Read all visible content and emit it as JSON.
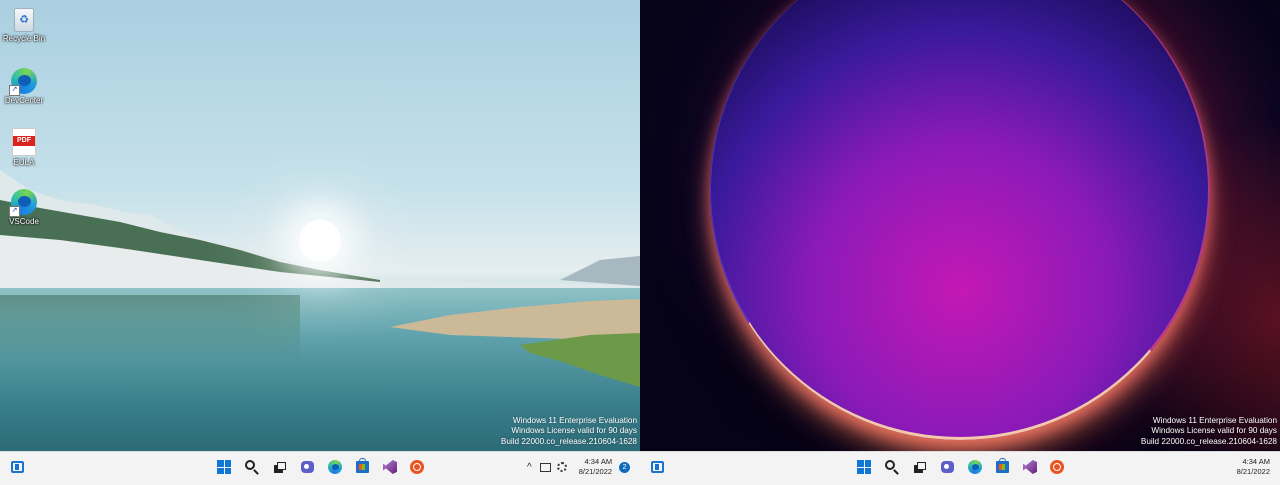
{
  "left_screen": {
    "desktop_icons": [
      {
        "label": "Recycle Bin",
        "icon": "recycle-bin-icon"
      },
      {
        "label": "DevCenter",
        "icon": "edge-icon"
      },
      {
        "label": "EULA",
        "icon": "pdf-icon",
        "badge": "PDF"
      },
      {
        "label": "VSCode",
        "icon": "edge-icon"
      }
    ],
    "watermark": [
      "Windows 11 Enterprise Evaluation",
      "Windows License valid for 90 days",
      "Build 22000.co_release.210604-1628"
    ],
    "taskbar": {
      "apps": [
        "widgets-icon",
        "start-icon",
        "search-icon",
        "task-view-icon",
        "chat-icon",
        "edge-icon",
        "store-icon",
        "visual-studio-icon",
        "ubuntu-icon"
      ],
      "tray_chevron": "^",
      "time": "4:34 AM",
      "date": "8/21/2022",
      "notification_count": "2"
    }
  },
  "right_screen": {
    "watermark": [
      "Windows 11 Enterprise Evaluation",
      "Windows License valid for 90 days",
      "Build 22000.co_release.210604-1628"
    ],
    "taskbar": {
      "apps": [
        "widgets-icon",
        "start-icon",
        "search-icon",
        "task-view-icon",
        "chat-icon",
        "edge-icon",
        "store-icon",
        "visual-studio-icon",
        "ubuntu-icon"
      ],
      "time": "4:34 AM",
      "date": "8/21/2022"
    }
  },
  "colors": {
    "taskbar_bg": "#f3f3f3",
    "accent": "#0f78d6"
  }
}
